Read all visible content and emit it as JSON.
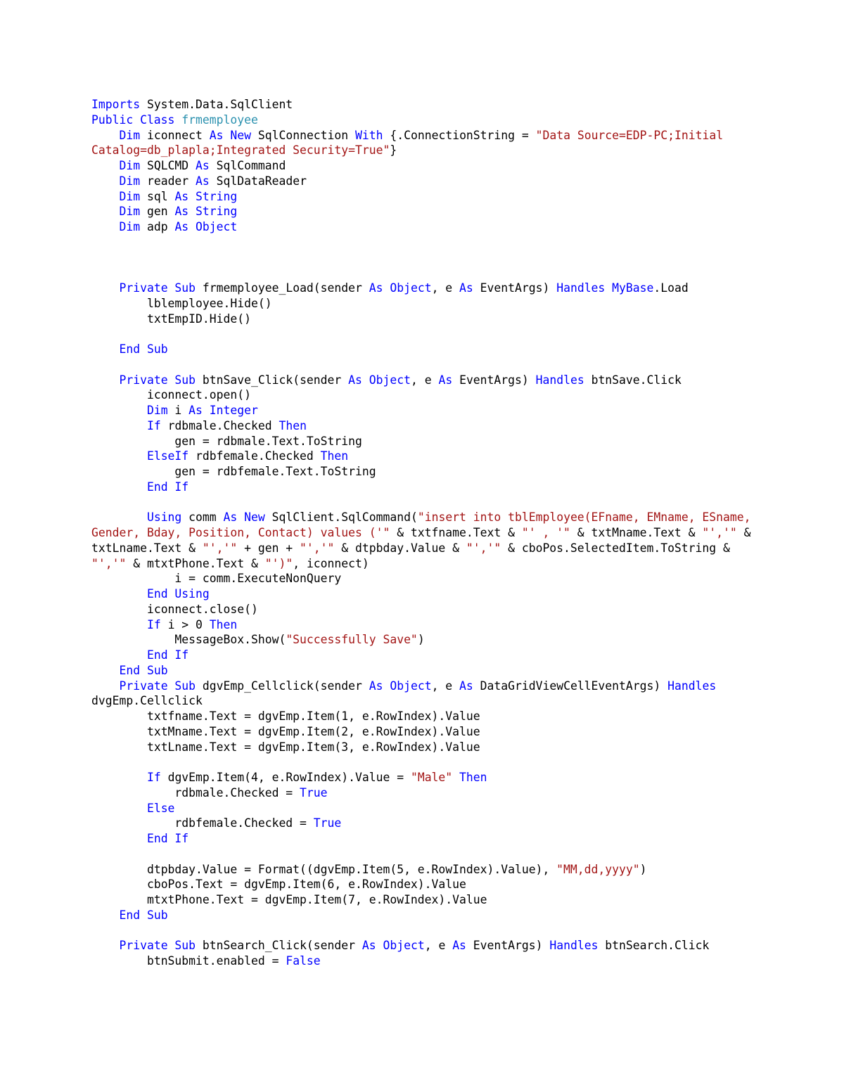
{
  "document": {
    "kind": "source-code-listing",
    "language": "Visual Basic .NET",
    "background_color": "#ffffff",
    "colors": {
      "keyword": "#0000ff",
      "type_name": "#2b91af",
      "string": "#a31515",
      "plain": "#000000"
    }
  },
  "code": {
    "lines": [
      {
        "id": "l1",
        "segments": [
          {
            "t": "Imports",
            "c": "kw"
          },
          {
            "t": " System.Data.SqlClient",
            "c": "pln"
          }
        ]
      },
      {
        "id": "l2",
        "segments": [
          {
            "t": "Public Class ",
            "c": "kw"
          },
          {
            "t": "frmemployee",
            "c": "typ"
          }
        ]
      },
      {
        "id": "l3",
        "segments": [
          {
            "t": "    ",
            "c": "pln"
          },
          {
            "t": "Dim",
            "c": "kw"
          },
          {
            "t": " iconnect ",
            "c": "pln"
          },
          {
            "t": "As New",
            "c": "kw"
          },
          {
            "t": " SqlConnection ",
            "c": "pln"
          },
          {
            "t": "With",
            "c": "kw"
          },
          {
            "t": " {.ConnectionString = ",
            "c": "pln"
          },
          {
            "t": "\"Data Source=EDP-PC;Initial Catalog=db_plapla;Integrated Security=True\"",
            "c": "str"
          },
          {
            "t": "}",
            "c": "pln"
          }
        ]
      },
      {
        "id": "l4",
        "segments": [
          {
            "t": "    ",
            "c": "pln"
          },
          {
            "t": "Dim",
            "c": "kw"
          },
          {
            "t": " SQLCMD ",
            "c": "pln"
          },
          {
            "t": "As",
            "c": "kw"
          },
          {
            "t": " SqlCommand",
            "c": "pln"
          }
        ]
      },
      {
        "id": "l5",
        "segments": [
          {
            "t": "    ",
            "c": "pln"
          },
          {
            "t": "Dim",
            "c": "kw"
          },
          {
            "t": " reader ",
            "c": "pln"
          },
          {
            "t": "As",
            "c": "kw"
          },
          {
            "t": " SqlDataReader",
            "c": "pln"
          }
        ]
      },
      {
        "id": "l6",
        "segments": [
          {
            "t": "    ",
            "c": "pln"
          },
          {
            "t": "Dim",
            "c": "kw"
          },
          {
            "t": " sql ",
            "c": "pln"
          },
          {
            "t": "As String",
            "c": "kw"
          }
        ]
      },
      {
        "id": "l7",
        "segments": [
          {
            "t": "    ",
            "c": "pln"
          },
          {
            "t": "Dim",
            "c": "kw"
          },
          {
            "t": " gen ",
            "c": "pln"
          },
          {
            "t": "As String",
            "c": "kw"
          }
        ]
      },
      {
        "id": "l8",
        "segments": [
          {
            "t": "    ",
            "c": "pln"
          },
          {
            "t": "Dim",
            "c": "kw"
          },
          {
            "t": " adp ",
            "c": "pln"
          },
          {
            "t": "As Object",
            "c": "kw"
          }
        ]
      },
      {
        "id": "l9",
        "segments": []
      },
      {
        "id": "l10",
        "segments": []
      },
      {
        "id": "l11",
        "segments": []
      },
      {
        "id": "l12",
        "segments": [
          {
            "t": "    ",
            "c": "pln"
          },
          {
            "t": "Private Sub",
            "c": "kw"
          },
          {
            "t": " frmemployee_Load(sender ",
            "c": "pln"
          },
          {
            "t": "As Object",
            "c": "kw"
          },
          {
            "t": ", e ",
            "c": "pln"
          },
          {
            "t": "As",
            "c": "kw"
          },
          {
            "t": " EventArgs) ",
            "c": "pln"
          },
          {
            "t": "Handles MyBase",
            "c": "kw"
          },
          {
            "t": ".Load",
            "c": "pln"
          }
        ]
      },
      {
        "id": "l13",
        "segments": [
          {
            "t": "        lblemployee.Hide()",
            "c": "pln"
          }
        ]
      },
      {
        "id": "l14",
        "segments": [
          {
            "t": "        txtEmpID.Hide()",
            "c": "pln"
          }
        ]
      },
      {
        "id": "l15",
        "segments": []
      },
      {
        "id": "l16",
        "segments": [
          {
            "t": "    ",
            "c": "pln"
          },
          {
            "t": "End Sub",
            "c": "kw"
          }
        ]
      },
      {
        "id": "l17",
        "segments": []
      },
      {
        "id": "l18",
        "segments": [
          {
            "t": "    ",
            "c": "pln"
          },
          {
            "t": "Private Sub",
            "c": "kw"
          },
          {
            "t": " btnSave_Click(sender ",
            "c": "pln"
          },
          {
            "t": "As Object",
            "c": "kw"
          },
          {
            "t": ", e ",
            "c": "pln"
          },
          {
            "t": "As",
            "c": "kw"
          },
          {
            "t": " EventArgs) ",
            "c": "pln"
          },
          {
            "t": "Handles",
            "c": "kw"
          },
          {
            "t": " btnSave.Click",
            "c": "pln"
          }
        ]
      },
      {
        "id": "l19",
        "segments": [
          {
            "t": "        iconnect.open()",
            "c": "pln"
          }
        ]
      },
      {
        "id": "l20",
        "segments": [
          {
            "t": "        ",
            "c": "pln"
          },
          {
            "t": "Dim",
            "c": "kw"
          },
          {
            "t": " i ",
            "c": "pln"
          },
          {
            "t": "As Integer",
            "c": "kw"
          }
        ]
      },
      {
        "id": "l21",
        "segments": [
          {
            "t": "        ",
            "c": "pln"
          },
          {
            "t": "If",
            "c": "kw"
          },
          {
            "t": " rdbmale.Checked ",
            "c": "pln"
          },
          {
            "t": "Then",
            "c": "kw"
          }
        ]
      },
      {
        "id": "l22",
        "segments": [
          {
            "t": "            gen = rdbmale.Text.ToString",
            "c": "pln"
          }
        ]
      },
      {
        "id": "l23",
        "segments": [
          {
            "t": "        ",
            "c": "pln"
          },
          {
            "t": "ElseIf",
            "c": "kw"
          },
          {
            "t": " rdbfemale.Checked ",
            "c": "pln"
          },
          {
            "t": "Then",
            "c": "kw"
          }
        ]
      },
      {
        "id": "l24",
        "segments": [
          {
            "t": "            gen = rdbfemale.Text.ToString",
            "c": "pln"
          }
        ]
      },
      {
        "id": "l25",
        "segments": [
          {
            "t": "        ",
            "c": "pln"
          },
          {
            "t": "End If",
            "c": "kw"
          }
        ]
      },
      {
        "id": "l26",
        "segments": []
      },
      {
        "id": "l27",
        "segments": [
          {
            "t": "        ",
            "c": "pln"
          },
          {
            "t": "Using",
            "c": "kw"
          },
          {
            "t": " comm ",
            "c": "pln"
          },
          {
            "t": "As New",
            "c": "kw"
          },
          {
            "t": " SqlClient.SqlCommand(",
            "c": "pln"
          },
          {
            "t": "\"insert into tblEmployee(EFname, EMname, ESname, Gender, Bday, Position, Contact) values ('\"",
            "c": "str"
          },
          {
            "t": " & txtfname.Text & ",
            "c": "pln"
          },
          {
            "t": "\"' , '\"",
            "c": "str"
          },
          {
            "t": " & txtMname.Text & ",
            "c": "pln"
          },
          {
            "t": "\"','\"",
            "c": "str"
          },
          {
            "t": " & txtLname.Text & ",
            "c": "pln"
          },
          {
            "t": "\"','\"",
            "c": "str"
          },
          {
            "t": " + gen + ",
            "c": "pln"
          },
          {
            "t": "\"','\"",
            "c": "str"
          },
          {
            "t": " & dtpbday.Value & ",
            "c": "pln"
          },
          {
            "t": "\"','\"",
            "c": "str"
          },
          {
            "t": " & cboPos.SelectedItem.ToString & ",
            "c": "pln"
          },
          {
            "t": "\"','\"",
            "c": "str"
          },
          {
            "t": " & mtxtPhone.Text & ",
            "c": "pln"
          },
          {
            "t": "\"')\"",
            "c": "str"
          },
          {
            "t": ", iconnect)",
            "c": "pln"
          }
        ]
      },
      {
        "id": "l28",
        "segments": [
          {
            "t": "            i = comm.ExecuteNonQuery",
            "c": "pln"
          }
        ]
      },
      {
        "id": "l29",
        "segments": [
          {
            "t": "        ",
            "c": "pln"
          },
          {
            "t": "End Using",
            "c": "kw"
          }
        ]
      },
      {
        "id": "l30",
        "segments": [
          {
            "t": "        iconnect.close()",
            "c": "pln"
          }
        ]
      },
      {
        "id": "l31",
        "segments": [
          {
            "t": "        ",
            "c": "pln"
          },
          {
            "t": "If",
            "c": "kw"
          },
          {
            "t": " i > 0 ",
            "c": "pln"
          },
          {
            "t": "Then",
            "c": "kw"
          }
        ]
      },
      {
        "id": "l32",
        "segments": [
          {
            "t": "            MessageBox.Show(",
            "c": "pln"
          },
          {
            "t": "\"Successfully Save\"",
            "c": "str"
          },
          {
            "t": ")",
            "c": "pln"
          }
        ]
      },
      {
        "id": "l33",
        "segments": [
          {
            "t": "        ",
            "c": "pln"
          },
          {
            "t": "End If",
            "c": "kw"
          }
        ]
      },
      {
        "id": "l34",
        "segments": [
          {
            "t": "    ",
            "c": "pln"
          },
          {
            "t": "End Sub",
            "c": "kw"
          }
        ]
      },
      {
        "id": "l35",
        "segments": [
          {
            "t": "    ",
            "c": "pln"
          },
          {
            "t": "Private Sub",
            "c": "kw"
          },
          {
            "t": " dgvEmp_Cellclick(sender ",
            "c": "pln"
          },
          {
            "t": "As Object",
            "c": "kw"
          },
          {
            "t": ", e ",
            "c": "pln"
          },
          {
            "t": "As",
            "c": "kw"
          },
          {
            "t": " DataGridViewCellEventArgs) ",
            "c": "pln"
          },
          {
            "t": "Handles",
            "c": "kw"
          },
          {
            "t": " dvgEmp.Cellclick",
            "c": "pln"
          }
        ]
      },
      {
        "id": "l36",
        "segments": [
          {
            "t": "        txtfname.Text = dgvEmp.Item(1, e.RowIndex).Value",
            "c": "pln"
          }
        ]
      },
      {
        "id": "l37",
        "segments": [
          {
            "t": "        txtMname.Text = dgvEmp.Item(2, e.RowIndex).Value",
            "c": "pln"
          }
        ]
      },
      {
        "id": "l38",
        "segments": [
          {
            "t": "        txtLname.Text = dgvEmp.Item(3, e.RowIndex).Value",
            "c": "pln"
          }
        ]
      },
      {
        "id": "l39",
        "segments": []
      },
      {
        "id": "l40",
        "segments": [
          {
            "t": "        ",
            "c": "pln"
          },
          {
            "t": "If",
            "c": "kw"
          },
          {
            "t": " dgvEmp.Item(4, e.RowIndex).Value = ",
            "c": "pln"
          },
          {
            "t": "\"Male\"",
            "c": "str"
          },
          {
            "t": " ",
            "c": "pln"
          },
          {
            "t": "Then",
            "c": "kw"
          }
        ]
      },
      {
        "id": "l41",
        "segments": [
          {
            "t": "            rdbmale.Checked = ",
            "c": "pln"
          },
          {
            "t": "True",
            "c": "kw"
          }
        ]
      },
      {
        "id": "l42",
        "segments": [
          {
            "t": "        ",
            "c": "pln"
          },
          {
            "t": "Else",
            "c": "kw"
          }
        ]
      },
      {
        "id": "l43",
        "segments": [
          {
            "t": "            rdbfemale.Checked = ",
            "c": "pln"
          },
          {
            "t": "True",
            "c": "kw"
          }
        ]
      },
      {
        "id": "l44",
        "segments": [
          {
            "t": "        ",
            "c": "pln"
          },
          {
            "t": "End If",
            "c": "kw"
          }
        ]
      },
      {
        "id": "l45",
        "segments": []
      },
      {
        "id": "l46",
        "segments": [
          {
            "t": "        dtpbday.Value = Format((dgvEmp.Item(5, e.RowIndex).Value), ",
            "c": "pln"
          },
          {
            "t": "\"MM,dd,yyyy\"",
            "c": "str"
          },
          {
            "t": ")",
            "c": "pln"
          }
        ]
      },
      {
        "id": "l47",
        "segments": [
          {
            "t": "        cboPos.Text = dgvEmp.Item(6, e.RowIndex).Value",
            "c": "pln"
          }
        ]
      },
      {
        "id": "l48",
        "segments": [
          {
            "t": "        mtxtPhone.Text = dgvEmp.Item(7, e.RowIndex).Value",
            "c": "pln"
          }
        ]
      },
      {
        "id": "l49",
        "segments": [
          {
            "t": "    ",
            "c": "pln"
          },
          {
            "t": "End Sub",
            "c": "kw"
          }
        ]
      },
      {
        "id": "l50",
        "segments": []
      },
      {
        "id": "l51",
        "segments": [
          {
            "t": "    ",
            "c": "pln"
          },
          {
            "t": "Private Sub",
            "c": "kw"
          },
          {
            "t": " btnSearch_Click(sender ",
            "c": "pln"
          },
          {
            "t": "As Object",
            "c": "kw"
          },
          {
            "t": ", e ",
            "c": "pln"
          },
          {
            "t": "As",
            "c": "kw"
          },
          {
            "t": " EventArgs) ",
            "c": "pln"
          },
          {
            "t": "Handles",
            "c": "kw"
          },
          {
            "t": " btnSearch.Click",
            "c": "pln"
          }
        ]
      },
      {
        "id": "l52",
        "segments": [
          {
            "t": "        btnSubmit.enabled = ",
            "c": "pln"
          },
          {
            "t": "False",
            "c": "kw"
          }
        ]
      }
    ]
  }
}
